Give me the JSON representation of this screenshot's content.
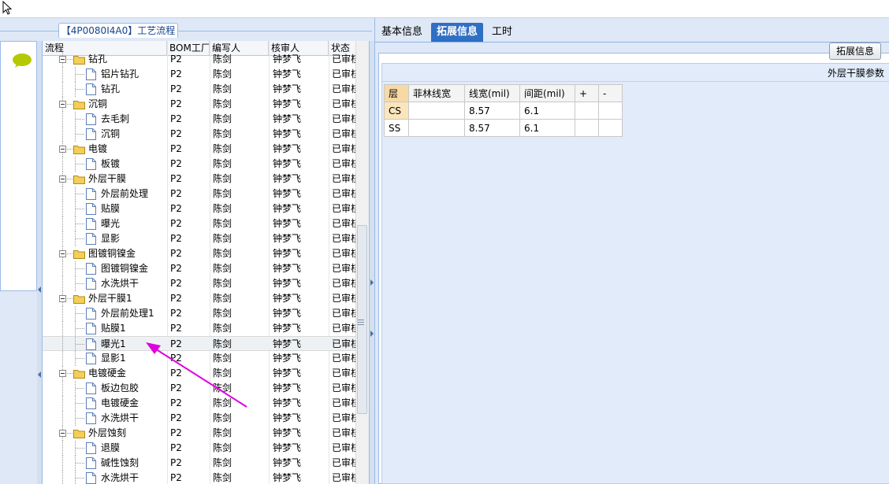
{
  "group_title": "【4P0080I4A0】工艺流程",
  "columns": {
    "flow": "流程",
    "bom": "BOM工厂",
    "writer": "编写人",
    "reviewer": "核审人",
    "status": "状态"
  },
  "rows": [
    {
      "type": "group",
      "label": "钻孔",
      "bom": "P2",
      "writer": "陈剑",
      "reviewer": "钟梦飞",
      "status": "已审核"
    },
    {
      "type": "item",
      "label": "铝片钻孔",
      "bom": "P2",
      "writer": "陈剑",
      "reviewer": "钟梦飞",
      "status": "已审核"
    },
    {
      "type": "item",
      "label": "钻孔",
      "bom": "P2",
      "writer": "陈剑",
      "reviewer": "钟梦飞",
      "status": "已审核"
    },
    {
      "type": "group",
      "label": "沉铜",
      "bom": "P2",
      "writer": "陈剑",
      "reviewer": "钟梦飞",
      "status": "已审核"
    },
    {
      "type": "item",
      "label": "去毛刺",
      "bom": "P2",
      "writer": "陈剑",
      "reviewer": "钟梦飞",
      "status": "已审核"
    },
    {
      "type": "item",
      "label": "沉铜",
      "bom": "P2",
      "writer": "陈剑",
      "reviewer": "钟梦飞",
      "status": "已审核"
    },
    {
      "type": "group",
      "label": "电镀",
      "bom": "P2",
      "writer": "陈剑",
      "reviewer": "钟梦飞",
      "status": "已审核"
    },
    {
      "type": "item",
      "label": "板镀",
      "bom": "P2",
      "writer": "陈剑",
      "reviewer": "钟梦飞",
      "status": "已审核"
    },
    {
      "type": "group",
      "label": "外层干膜",
      "bom": "P2",
      "writer": "陈剑",
      "reviewer": "钟梦飞",
      "status": "已审核"
    },
    {
      "type": "item",
      "label": "外层前处理",
      "bom": "P2",
      "writer": "陈剑",
      "reviewer": "钟梦飞",
      "status": "已审核"
    },
    {
      "type": "item",
      "label": "贴膜",
      "bom": "P2",
      "writer": "陈剑",
      "reviewer": "钟梦飞",
      "status": "已审核"
    },
    {
      "type": "item",
      "label": "曝光",
      "bom": "P2",
      "writer": "陈剑",
      "reviewer": "钟梦飞",
      "status": "已审核"
    },
    {
      "type": "item",
      "label": "显影",
      "bom": "P2",
      "writer": "陈剑",
      "reviewer": "钟梦飞",
      "status": "已审核"
    },
    {
      "type": "group",
      "label": "图镀铜镍金",
      "bom": "P2",
      "writer": "陈剑",
      "reviewer": "钟梦飞",
      "status": "已审核"
    },
    {
      "type": "item",
      "label": "图镀铜镍金",
      "bom": "P2",
      "writer": "陈剑",
      "reviewer": "钟梦飞",
      "status": "已审核"
    },
    {
      "type": "item",
      "label": "水洗烘干",
      "bom": "P2",
      "writer": "陈剑",
      "reviewer": "钟梦飞",
      "status": "已审核"
    },
    {
      "type": "group",
      "label": "外层干膜1",
      "bom": "P2",
      "writer": "陈剑",
      "reviewer": "钟梦飞",
      "status": "已审核"
    },
    {
      "type": "item",
      "label": "外层前处理1",
      "bom": "P2",
      "writer": "陈剑",
      "reviewer": "钟梦飞",
      "status": "已审核"
    },
    {
      "type": "item",
      "label": "贴膜1",
      "bom": "P2",
      "writer": "陈剑",
      "reviewer": "钟梦飞",
      "status": "已审核"
    },
    {
      "type": "item",
      "label": "曝光1",
      "bom": "P2",
      "writer": "陈剑",
      "reviewer": "钟梦飞",
      "status": "已审核",
      "selected": true
    },
    {
      "type": "item",
      "label": "显影1",
      "bom": "P2",
      "writer": "陈剑",
      "reviewer": "钟梦飞",
      "status": "已审核"
    },
    {
      "type": "group",
      "label": "电镀硬金",
      "bom": "P2",
      "writer": "陈剑",
      "reviewer": "钟梦飞",
      "status": "已审核"
    },
    {
      "type": "item",
      "label": "板边包胶",
      "bom": "P2",
      "writer": "陈剑",
      "reviewer": "钟梦飞",
      "status": "已审核"
    },
    {
      "type": "item",
      "label": "电镀硬金",
      "bom": "P2",
      "writer": "陈剑",
      "reviewer": "钟梦飞",
      "status": "已审核"
    },
    {
      "type": "item",
      "label": "水洗烘干",
      "bom": "P2",
      "writer": "陈剑",
      "reviewer": "钟梦飞",
      "status": "已审核"
    },
    {
      "type": "group",
      "label": "外层蚀刻",
      "bom": "P2",
      "writer": "陈剑",
      "reviewer": "钟梦飞",
      "status": "已审核"
    },
    {
      "type": "item",
      "label": "退膜",
      "bom": "P2",
      "writer": "陈剑",
      "reviewer": "钟梦飞",
      "status": "已审核"
    },
    {
      "type": "item",
      "label": "碱性蚀刻",
      "bom": "P2",
      "writer": "陈剑",
      "reviewer": "钟梦飞",
      "status": "已审核"
    },
    {
      "type": "item",
      "label": "水洗烘干",
      "bom": "P2",
      "writer": "陈剑",
      "reviewer": "钟梦飞",
      "status": "已审核"
    }
  ],
  "tabs": [
    {
      "label": "基本信息",
      "active": false
    },
    {
      "label": "拓展信息",
      "active": true
    },
    {
      "label": "工时",
      "active": false
    }
  ],
  "ext_button": "拓展信息",
  "param_title": "外层干膜参数",
  "param_table": {
    "headers": [
      "层",
      "菲林线宽",
      "线宽(mil)",
      "间距(mil)",
      "+",
      "-"
    ],
    "rows": [
      [
        "CS",
        "",
        "8.57",
        "6.1",
        "",
        ""
      ],
      [
        "SS",
        "",
        "8.57",
        "6.1",
        "",
        ""
      ]
    ]
  },
  "colors": {
    "accent": "#2f6fc4",
    "panel_bg": "#dfe8f6",
    "arrow": "#e000e0"
  }
}
